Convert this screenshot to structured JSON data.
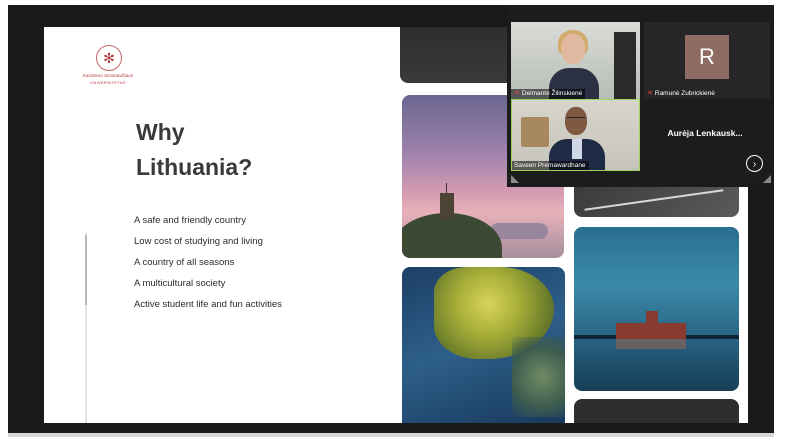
{
  "slide": {
    "logo": {
      "name": "Kazimiero Simonavičiaus",
      "subname": "UNIVERSITETAS"
    },
    "title": "Why\nLithuania?",
    "bullets": [
      "A safe and friendly country",
      "Low cost of studying and living",
      "A country of all seasons",
      "A multicultural society",
      "Active student life and fun activities"
    ]
  },
  "video": {
    "participants": [
      {
        "name": "Deimantė Žilinskienė",
        "muted": true
      },
      {
        "name": "Ramunė Zubrickienė",
        "initial": "R",
        "muted": true
      },
      {
        "name": "Saveen Premawardhane",
        "muted": false
      },
      {
        "name": "Aurėja Lenkausk..."
      }
    ],
    "next_label": "›"
  },
  "icons": {
    "mic_off": "mic-off-icon",
    "next": "chevron-right-icon"
  }
}
